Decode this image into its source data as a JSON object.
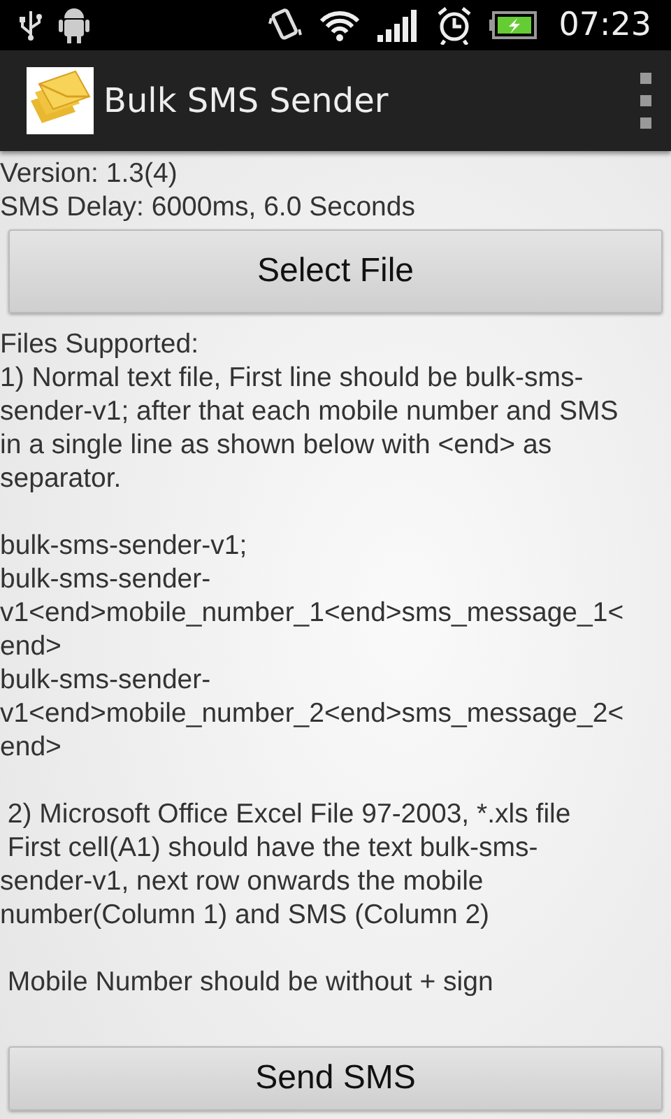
{
  "status_bar": {
    "time": "07:23"
  },
  "app_bar": {
    "title": "Bulk SMS Sender"
  },
  "info": [
    "Version: 1.3(4)",
    "SMS Delay: 6000ms, 6.0 Seconds"
  ],
  "select_button": "Select File",
  "instructions": [
    "Files Supported:\n1) Normal text file, First line should be bulk-sms-\nsender-v1; after that each mobile number and SMS\nin a single line as shown below with <end> as\nseparator.",
    "bulk-sms-sender-v1;\nbulk-sms-sender-\nv1<end>mobile_number_1<end>sms_message_1<\nend>\nbulk-sms-sender-\nv1<end>mobile_number_2<end>sms_message_2<\nend>",
    " 2) Microsoft Office Excel File 97-2003, *.xls file\n First cell(A1) should have the text bulk-sms-\nsender-v1, next row onwards the mobile\nnumber(Column 1) and SMS (Column 2)",
    " Mobile Number should be without + sign"
  ],
  "send_button": "Send SMS"
}
